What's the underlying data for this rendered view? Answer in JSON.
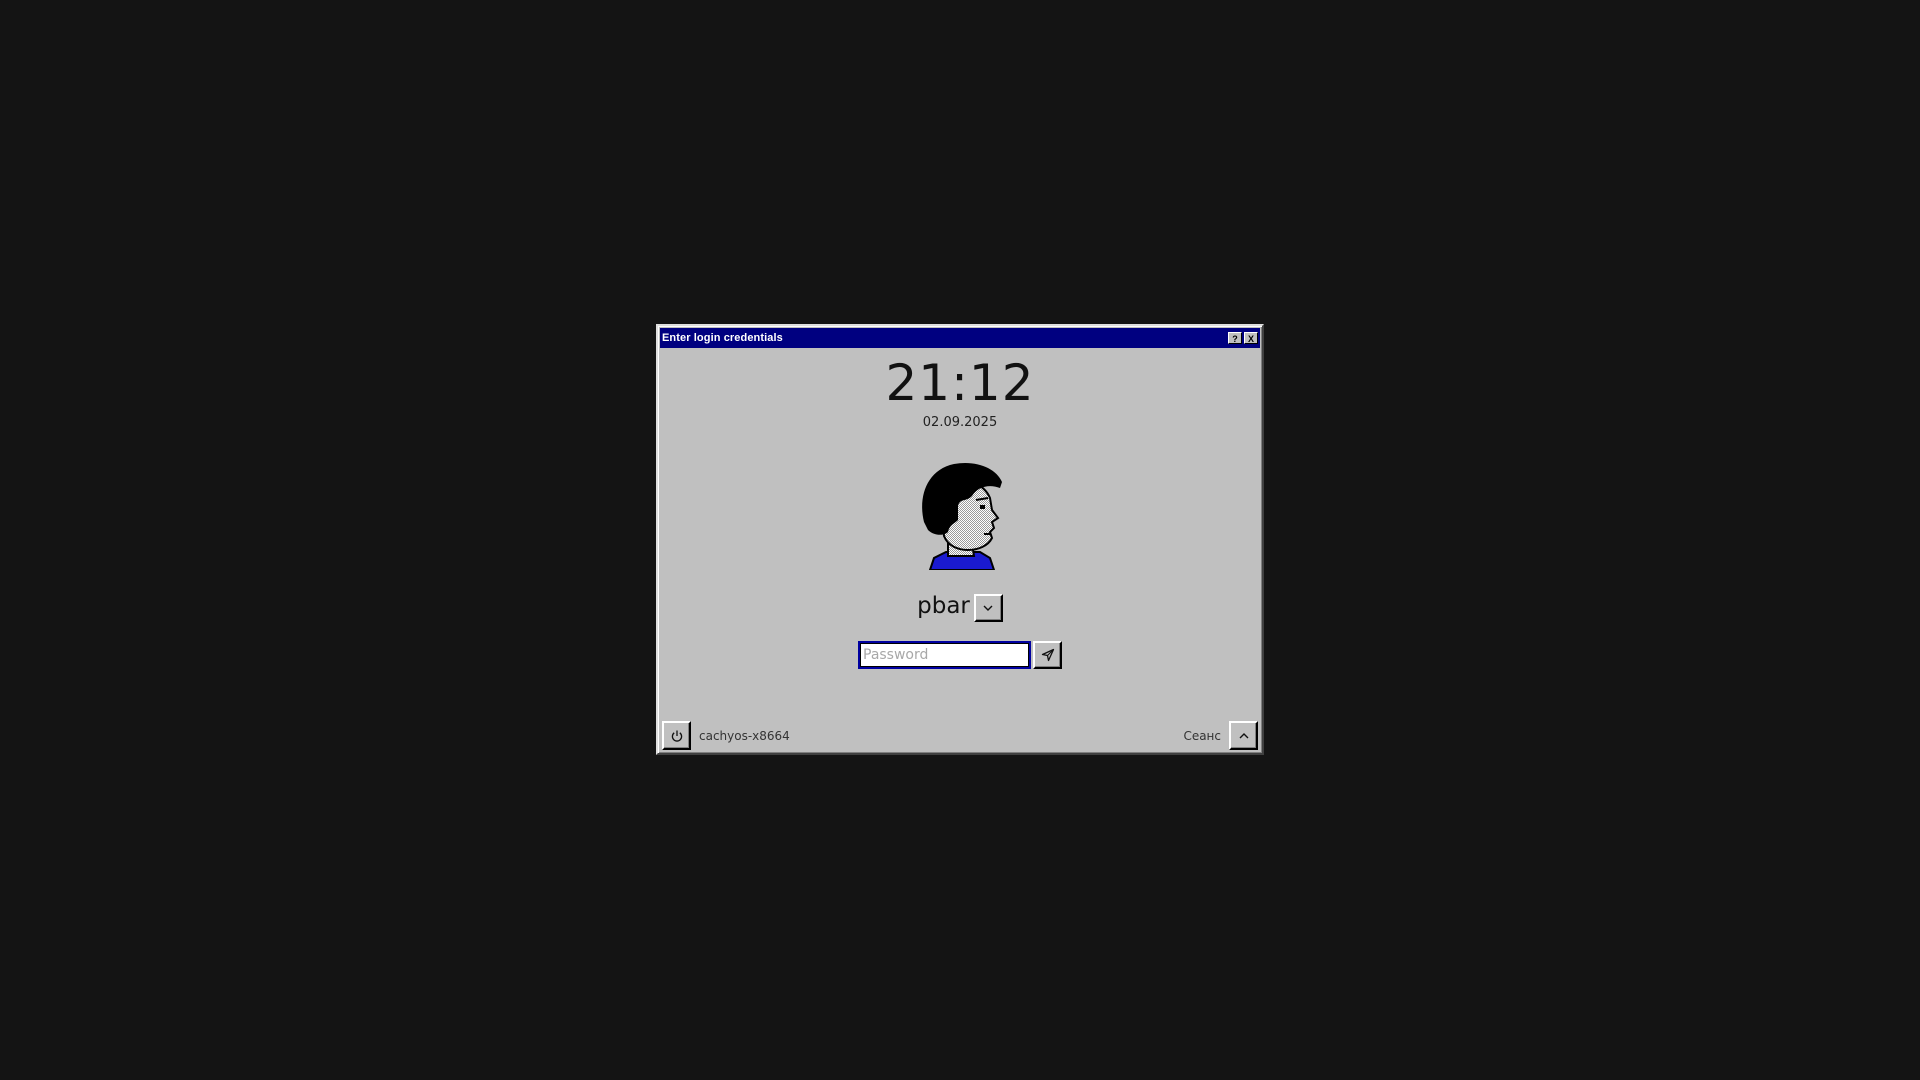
{
  "dialog": {
    "title": "Enter login credentials",
    "help_label": "?",
    "close_label": "X"
  },
  "clock": {
    "time": "21:12",
    "date": "02.09.2025"
  },
  "user": {
    "name": "pbar",
    "dropdown_icon": "chevron-down-icon"
  },
  "password": {
    "placeholder": "Password",
    "value": "",
    "submit_icon": "send-icon"
  },
  "footer": {
    "power_icon": "power-icon",
    "hostname": "cachyos-x8664",
    "session_label": "Сеанс",
    "session_icon": "chevron-up-icon"
  },
  "colors": {
    "background": "#141414",
    "window": "#c0c0c0",
    "titlebar": "#000080",
    "avatar_shirt": "#1a1ad0"
  }
}
